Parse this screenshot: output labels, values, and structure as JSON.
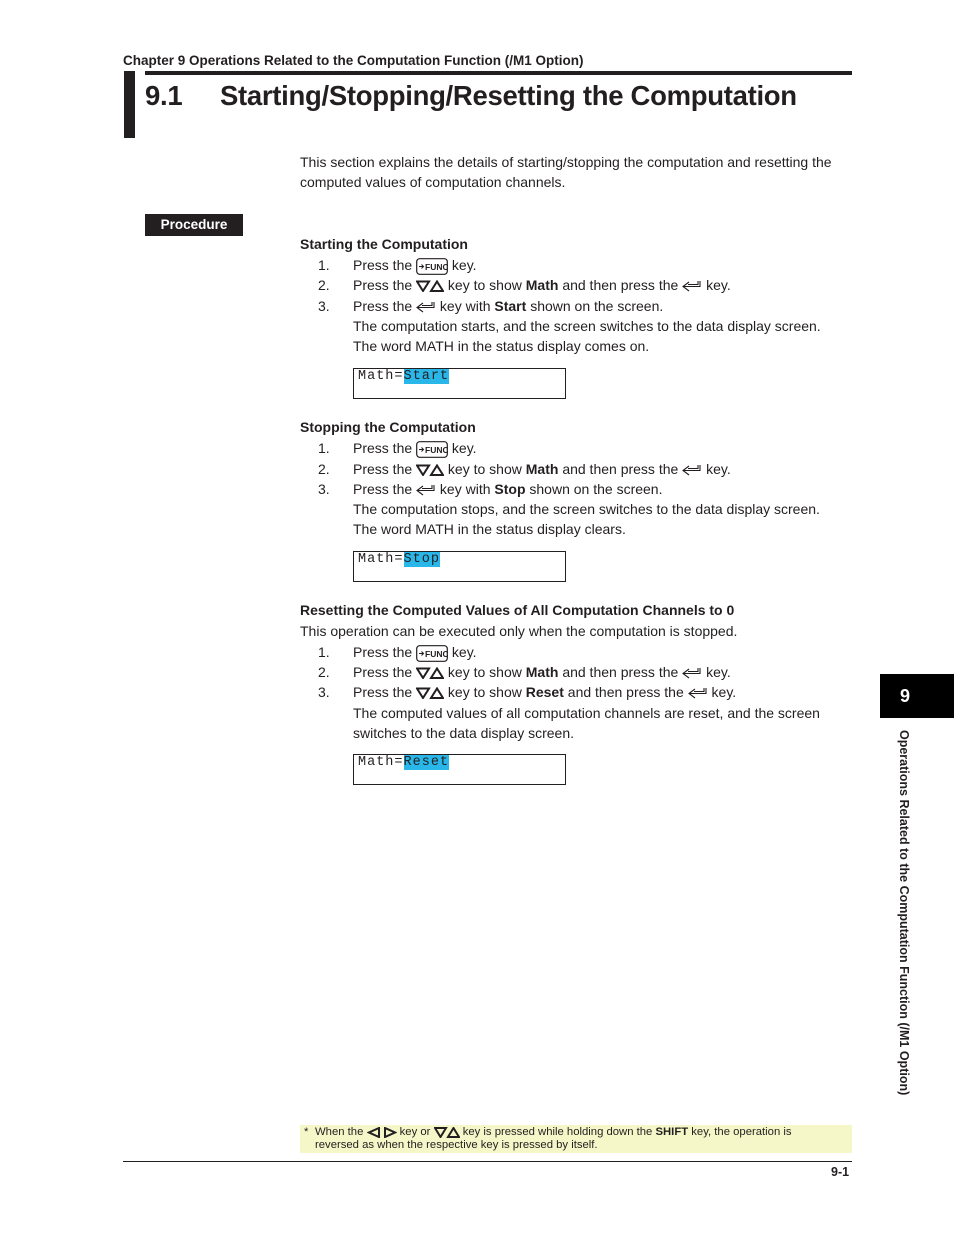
{
  "header": {
    "chapter": "Chapter 9  Operations Related to the Computation Function (/M1 Option)",
    "section_number": "9.1",
    "section_title": "Starting/Stopping/Resetting the Computation"
  },
  "intro": "This section explains the details of starting/stopping the computation and resetting the computed values of computation channels.",
  "procedure_label": "Procedure",
  "sections": [
    {
      "title": "Starting the Computation",
      "steps": [
        {
          "num": "1.",
          "pre": "Press the",
          "key": "func-key",
          "post": "key."
        },
        {
          "num": "2.",
          "pre": "Press the",
          "key": "down-up-arrow-keys",
          "mid1": "key to show",
          "bold": "Math",
          "mid2": "and then press the",
          "key2": "enter-key",
          "post": "key."
        },
        {
          "num": "3.",
          "pre": "Press the",
          "key": "enter-key",
          "mid1": "key with",
          "bold": "Start",
          "post": "shown on the screen."
        }
      ],
      "notes": [
        "The computation starts, and the screen switches to the data display screen.",
        "The word MATH in the status display comes on."
      ],
      "lcd": {
        "prefix": "Math=",
        "value": "Start"
      }
    },
    {
      "title": "Stopping the Computation",
      "steps": [
        {
          "num": "1.",
          "pre": "Press the",
          "key": "func-key",
          "post": "key."
        },
        {
          "num": "2.",
          "pre": "Press the",
          "key": "down-up-arrow-keys",
          "mid1": "key to show",
          "bold": "Math",
          "mid2": "and then press the",
          "key2": "enter-key",
          "post": "key."
        },
        {
          "num": "3.",
          "pre": "Press the",
          "key": "enter-key",
          "mid1": "key with",
          "bold": "Stop",
          "post": "shown on the screen."
        }
      ],
      "notes": [
        "The computation stops, and the screen switches to the data display screen.",
        "The word MATH in the status display clears."
      ],
      "lcd": {
        "prefix": "Math=",
        "value": "Stop"
      }
    },
    {
      "title": "Resetting the Computed Values of All Computation Channels to 0",
      "subtitle": "This operation can be executed only when the computation is stopped.",
      "steps": [
        {
          "num": "1.",
          "pre": "Press the",
          "key": "func-key",
          "post": "key."
        },
        {
          "num": "2.",
          "pre": "Press the",
          "key": "down-up-arrow-keys",
          "mid1": "key to show",
          "bold": "Math",
          "mid2": "and then press the",
          "key2": "enter-key",
          "post": "key."
        },
        {
          "num": "3.",
          "pre": "Press the",
          "key": "down-up-arrow-keys",
          "mid1": "key to show",
          "bold": "Reset",
          "mid2": "and then press the",
          "key2": "enter-key",
          "post": "key."
        }
      ],
      "notes": [
        "The computed values of all computation channels are reset, and the screen",
        "switches to the data display screen."
      ],
      "lcd": {
        "prefix": "Math=",
        "value": "Reset"
      }
    }
  ],
  "key_label_func": "FUNC",
  "side_tab": {
    "number": "9",
    "text": "Operations Related to the Computation Function (/M1 Option)"
  },
  "footnote": {
    "star": "*",
    "part1": "When the",
    "part2": "key or",
    "part3": "key is pressed while holding down the",
    "shift": "SHIFT",
    "part4": "key, the operation is",
    "line2": "reversed as when the respective key is pressed by itself."
  },
  "colors": {
    "lcd_highlight": "#29b6e8",
    "footnote_bg": "#f5f7c8"
  },
  "page_number": "9-1"
}
